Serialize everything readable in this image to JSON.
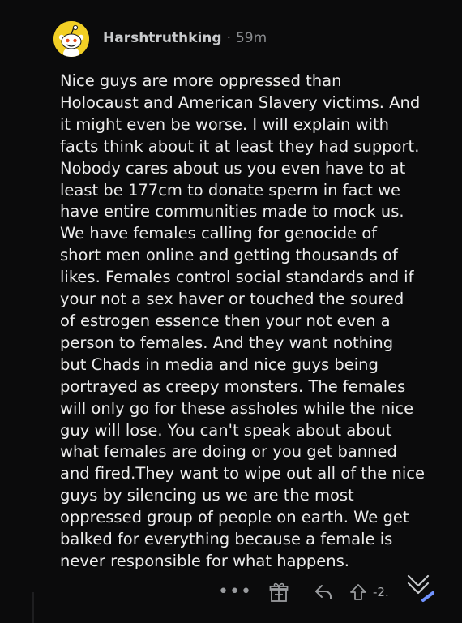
{
  "comment": {
    "author": "Harshtruthking",
    "separator": "·",
    "age": "59m",
    "body_lines": [
      "Nice guys are more oppressed than",
      "Holocaust and American Slavery victims. And",
      "it might even be worse. I will explain with",
      "facts think about it at least they had support.",
      "Nobody cares about us you even have to at",
      "least be 177cm to donate sperm in fact we",
      "have entire communities made to mock us.",
      "We have females calling for genocide of",
      "short men online and getting thousands of",
      "likes. Females control social standards and if",
      "your not a sex haver or touched the soured",
      "of estrogen essence then your not even a",
      "person to females. And they want nothing",
      "but Chads in media and nice guys being",
      "portrayed as creepy monsters. The females",
      "will only go for these assholes while the nice",
      "guy will lose. You can't speak about about",
      "what females are doing or you get banned",
      "and fired.They want to wipe out all of the nice",
      "guys by silencing us we are the most",
      "oppressed group of people on earth. We get",
      "balked for everything because a female is",
      "never responsible for what happens."
    ]
  },
  "actions": {
    "more": "•••",
    "score": "-2.",
    "icons": [
      "more-icon",
      "award-icon",
      "reply-icon",
      "upvote-icon",
      "downvote-icon"
    ]
  },
  "colors": {
    "background": "#0b0b0c",
    "text": "#ececec",
    "avatar": "#f2cf25",
    "muted": "#8a8c8f",
    "downvote_accent": "#7193ff"
  }
}
